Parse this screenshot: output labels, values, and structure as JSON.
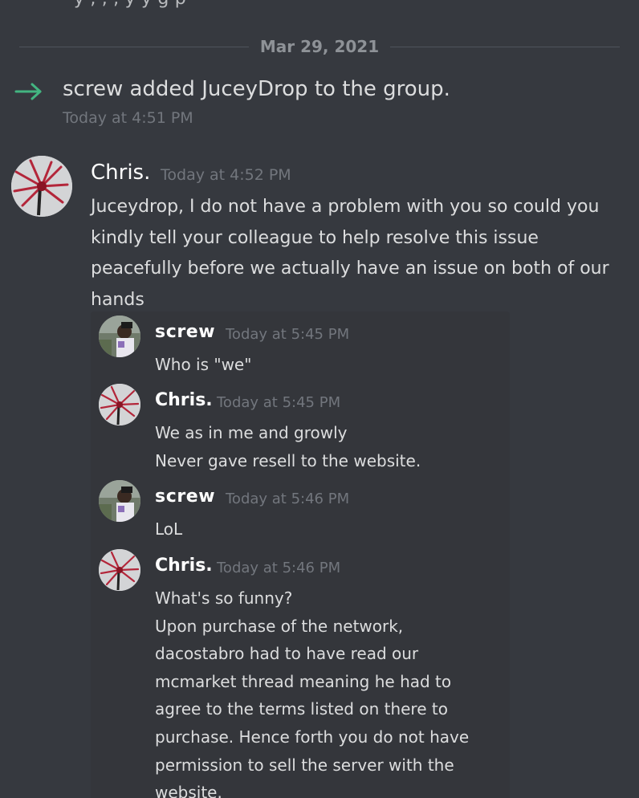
{
  "top_cutoff": "y , , , y y g p",
  "date_divider": "Mar 29, 2021",
  "system_message": {
    "text": "screw added JuceyDrop to the group.",
    "time": "Today at 4:51 PM",
    "arrow_color": "#43b581"
  },
  "main_message": {
    "author": "Chris.",
    "time": "Today at 4:52 PM",
    "body": "Juceydrop, I do not have a problem with you so could you kindly tell your colleague to help resolve this issue peacefully before we actually have an issue on both of our hands"
  },
  "quoted_messages": [
    {
      "author": "screw",
      "time": "Today at 5:45 PM",
      "lines": [
        "Who is \"we\""
      ],
      "avatar": "photo-avatar"
    },
    {
      "author": "Chris.",
      "time": "Today at 5:45 PM",
      "lines": [
        "We as in me and growly",
        "Never gave resell to the website."
      ],
      "avatar": "red-spiky-avatar"
    },
    {
      "author": "screw",
      "time": "Today at 5:46 PM",
      "lines": [
        "LoL"
      ],
      "avatar": "photo-avatar"
    },
    {
      "author": "Chris.",
      "time": "Today at 5:46 PM",
      "lines": [
        "What's so funny?",
        "Upon purchase of the network,",
        "dacostabro had to have read our",
        "mcmarket thread meaning he had to",
        "agree to the terms listed on there to",
        "purchase. Hence forth you do not have",
        "permission to sell the server with the",
        "website."
      ],
      "avatar": "red-spiky-avatar"
    }
  ],
  "colors": {
    "background": "#36393f",
    "text": "#dcddde",
    "muted": "#72767d",
    "author": "#ffffff",
    "accent_green": "#43b581"
  }
}
